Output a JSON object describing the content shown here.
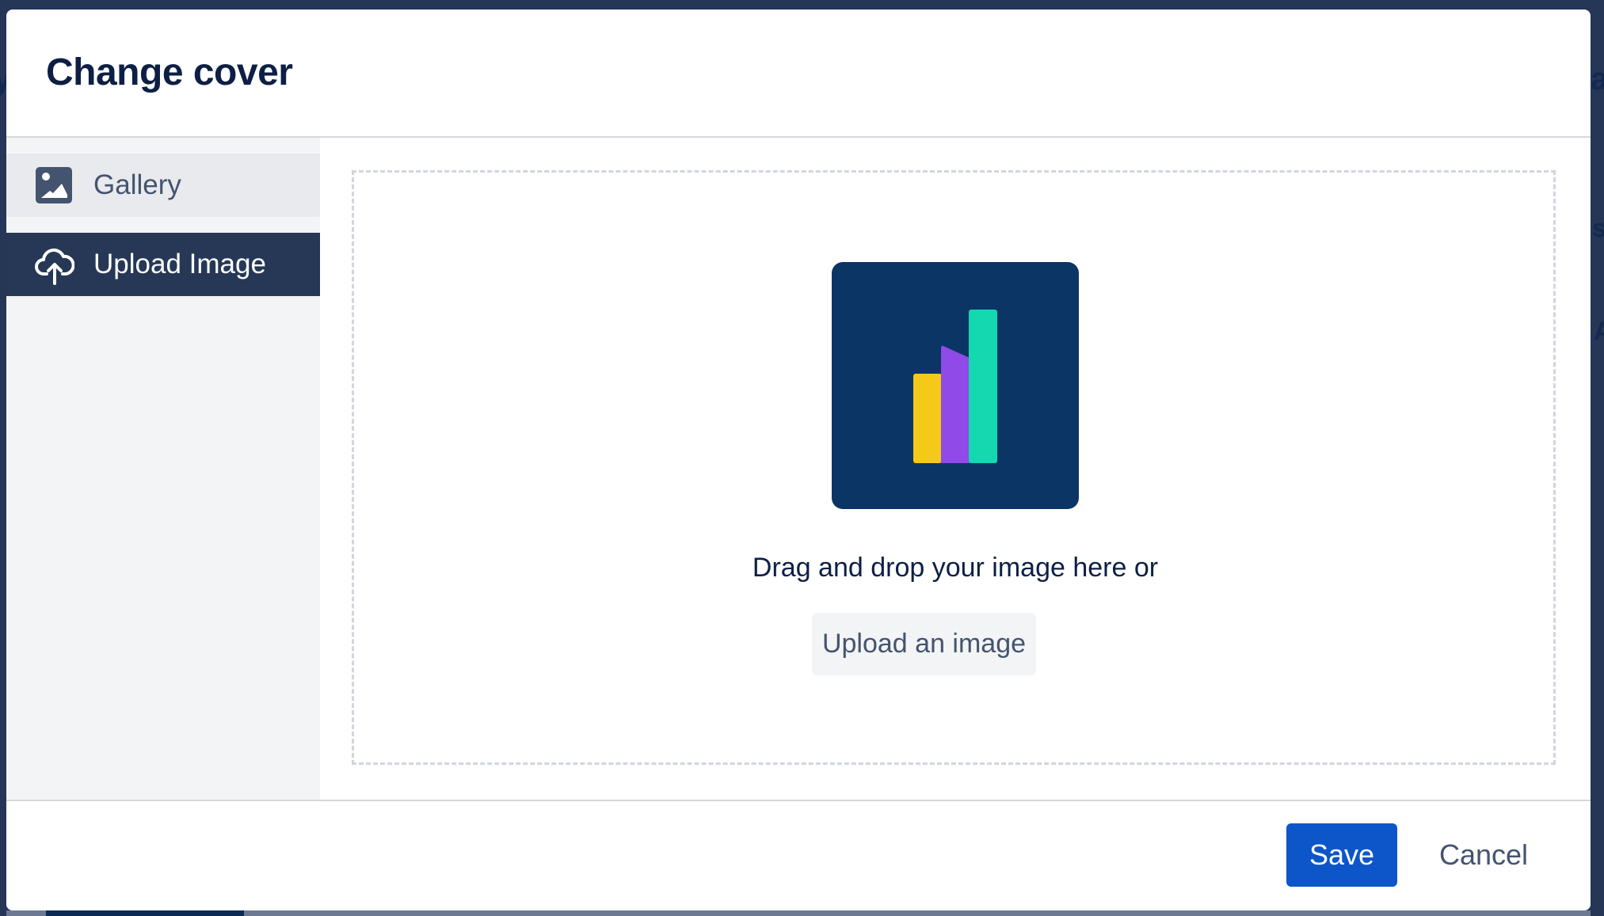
{
  "background": {
    "fragments": [
      "y",
      "ar",
      "s",
      "A"
    ]
  },
  "dialog": {
    "title": "Change cover",
    "sidebar": {
      "items": [
        {
          "label": "Gallery",
          "icon": "image-icon",
          "selected": false
        },
        {
          "label": "Upload Image",
          "icon": "cloud-upload-icon",
          "selected": true
        }
      ]
    },
    "upload": {
      "logo_icon": "bar-chart-logo-icon",
      "logo_colors": {
        "background": "#0b3565",
        "bar1": "#f5c919",
        "bar2": "#8f4ae8",
        "bar3": "#13d8b0"
      },
      "prompt": "Drag and drop your image here or",
      "button_label": "Upload an image"
    },
    "footer": {
      "save_label": "Save",
      "cancel_label": "Cancel"
    }
  },
  "colors": {
    "primary": "#0c56c9",
    "selected_nav": "#263856",
    "text_dark": "#0e1f45",
    "text_muted": "#44546f"
  }
}
